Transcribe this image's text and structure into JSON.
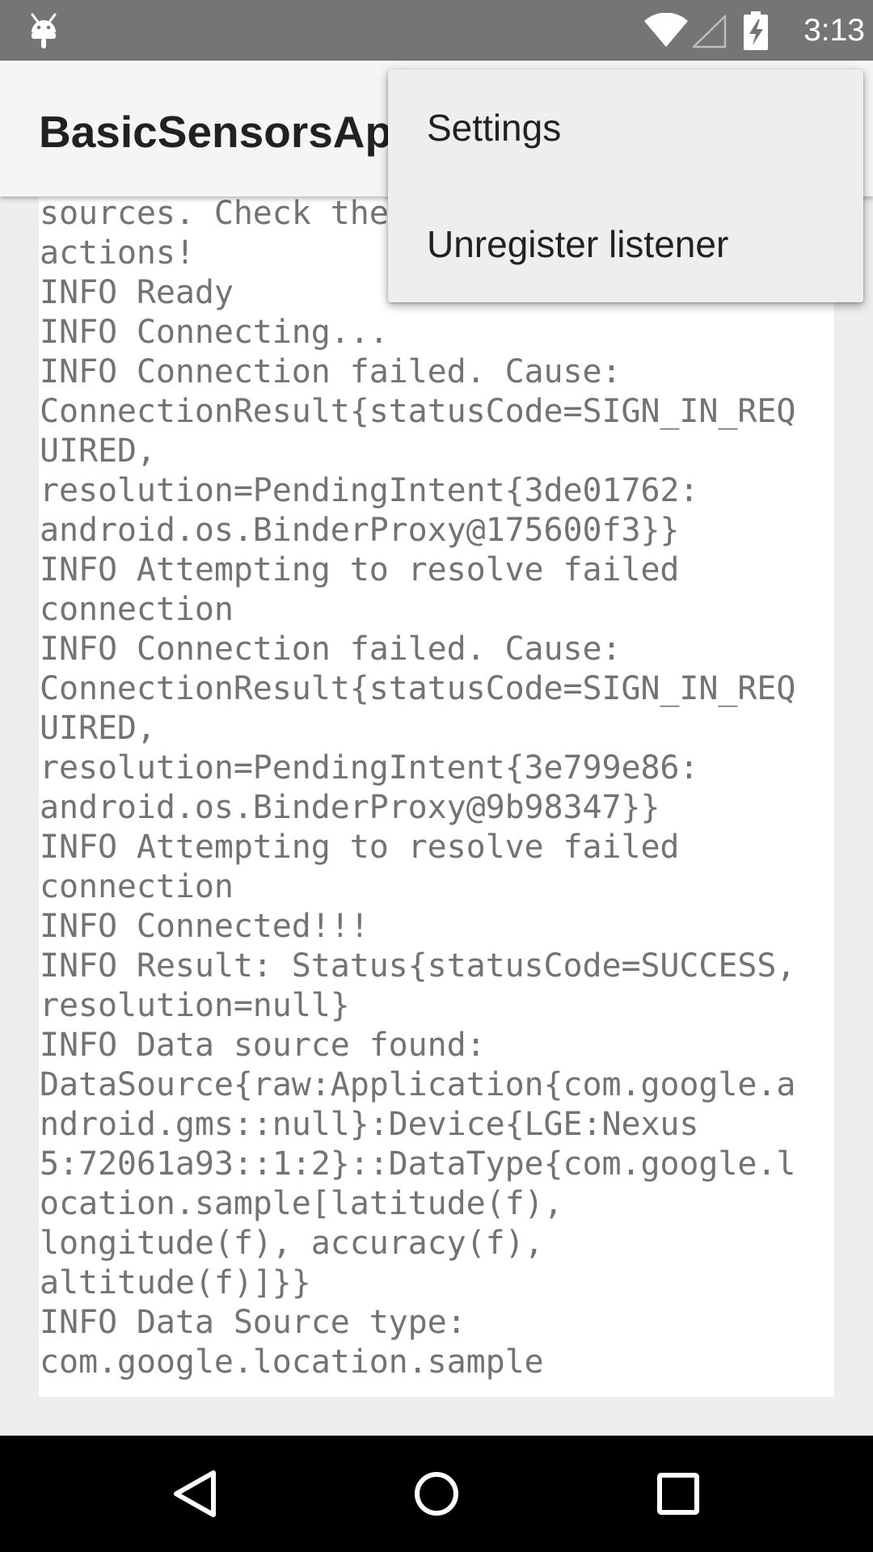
{
  "status_bar": {
    "time": "3:13",
    "icons": [
      "android-debug-icon",
      "wifi-icon",
      "signal-icon",
      "battery-charging-icon"
    ]
  },
  "app_bar": {
    "title": "BasicSensorsApi"
  },
  "overflow_menu": {
    "items": [
      {
        "label": "Settings"
      },
      {
        "label": "Unregister listener"
      }
    ]
  },
  "log": {
    "lines": [
      "sources. Check the",
      "actions!",
      "INFO Ready",
      "INFO Connecting...",
      "INFO Connection failed. Cause:",
      "ConnectionResult{statusCode=SIGN_IN_REQ",
      "UIRED,",
      "resolution=PendingIntent{3de01762:",
      "android.os.BinderProxy@175600f3}}",
      "INFO Attempting to resolve failed",
      "connection",
      "INFO Connection failed. Cause:",
      "ConnectionResult{statusCode=SIGN_IN_REQ",
      "UIRED,",
      "resolution=PendingIntent{3e799e86:",
      "android.os.BinderProxy@9b98347}}",
      "INFO Attempting to resolve failed",
      "connection",
      "INFO Connected!!!",
      "INFO Result: Status{statusCode=SUCCESS,",
      "resolution=null}",
      "INFO Data source found:",
      "DataSource{raw:Application{com.google.a",
      "ndroid.gms::null}:Device{LGE:Nexus",
      "5:72061a93::1:2}::DataType{com.google.l",
      "ocation.sample[latitude(f),",
      "longitude(f), accuracy(f),",
      "altitude(f)]}}",
      "INFO Data Source type:",
      "com.google.location.sample"
    ]
  },
  "nav_bar": {
    "buttons": [
      "back-icon",
      "home-icon",
      "recents-icon"
    ]
  }
}
